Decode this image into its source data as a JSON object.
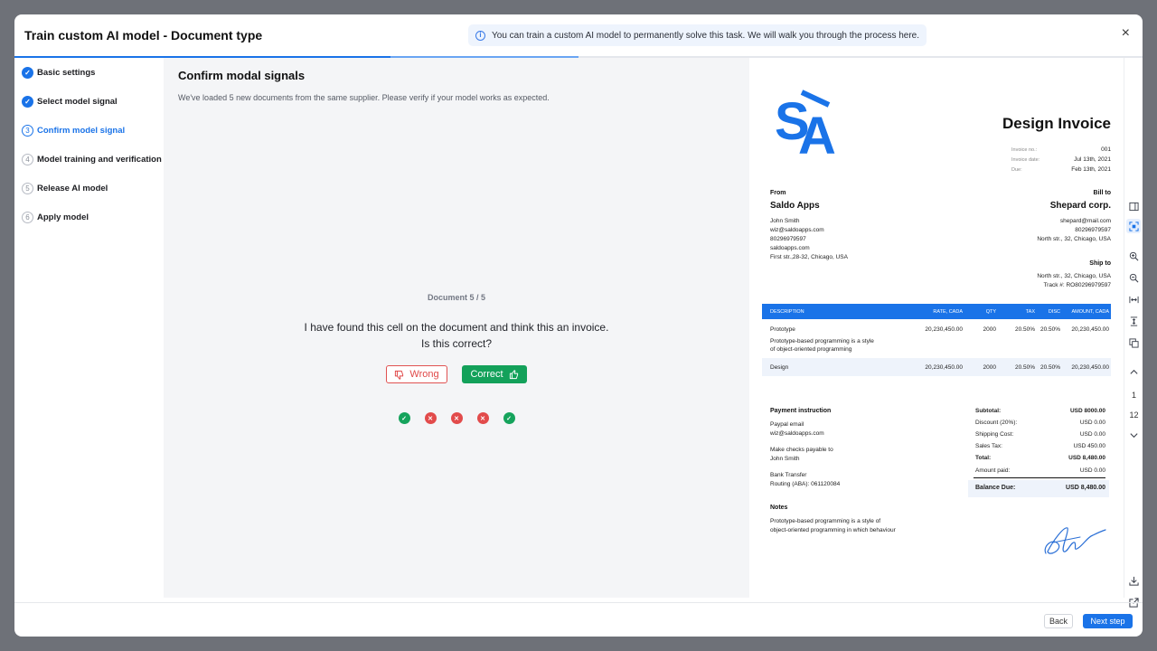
{
  "modal": {
    "title": "Train custom AI model - Document type",
    "info_banner": "You can train a custom AI model to permanently solve this task. We will walk you through the process here.",
    "close": "×"
  },
  "steps": [
    {
      "label": "Basic settings",
      "status": "done",
      "badge": "✓"
    },
    {
      "label": "Select model signal",
      "status": "done",
      "badge": "✓"
    },
    {
      "label": "Confirm model signal",
      "status": "active",
      "badge": "3"
    },
    {
      "label": "Model training and verification",
      "status": "pending",
      "badge": "4"
    },
    {
      "label": "Release AI model",
      "status": "pending",
      "badge": "5"
    },
    {
      "label": "Apply model",
      "status": "pending",
      "badge": "6"
    }
  ],
  "content": {
    "title": "Confirm modal signals",
    "subtitle": "We've loaded 5 new documents from the same supplier. Please verify if your model works as expected.",
    "document_counter": "Document 5 / 5",
    "question_line1": "I have found this cell on the document and think this an invoice.",
    "question_line2": "Is this correct?",
    "wrong_label": "Wrong",
    "correct_label": "Correct",
    "results": [
      "correct",
      "wrong",
      "wrong",
      "wrong",
      "correct"
    ]
  },
  "invoice": {
    "title": "Design Invoice",
    "meta": [
      {
        "label": "Invoice no.:",
        "value": "001"
      },
      {
        "label": "Invoice date:",
        "value": "Jul 13th, 2021"
      },
      {
        "label": "Due:",
        "value": "Feb 13th, 2021"
      }
    ],
    "from_heading": "From",
    "from_name": "Saldo Apps",
    "from_lines": [
      "John Smith",
      "wiz@saldoapps.com",
      "80296979597",
      "saldoapps.com",
      "First str.,28-32, Chicago, USA"
    ],
    "bill_heading": "Bill to",
    "bill_name": "Shepard corp.",
    "bill_lines": [
      "shepard@mail.com",
      "80296979597",
      "North str., 32, Chicago, USA"
    ],
    "ship_heading": "Ship to",
    "ship_lines": [
      "North str., 32, Chicago, USA",
      "Track #: RO80296979597"
    ],
    "table_headers": [
      "DESCRIPTION",
      "RATE, CADA",
      "QTY",
      "TAX",
      "DISC",
      "AMOUNT, CADA"
    ],
    "rows": [
      {
        "desc": "Prototype",
        "note1": "Prototype-based programming is a style",
        "note2": "of object-oriented programming",
        "rate": "20,230,450.00",
        "qty": "2000",
        "tax": "20.50%",
        "disc": "20.50%",
        "amount": "20,230,450.00"
      },
      {
        "desc": "Design",
        "rate": "20,230,450.00",
        "qty": "2000",
        "tax": "20.50%",
        "disc": "20.50%",
        "amount": "20,230,450.00"
      }
    ],
    "payment_heading": "Payment instruction",
    "payment_lines": [
      "Paypal email",
      "wiz@saldoapps.com",
      "Make checks payable to",
      "John Smith",
      "Bank Transfer",
      "Routing (ABA): 061120084"
    ],
    "totals": [
      {
        "label": "Subtotal:",
        "value": "USD 8000.00"
      },
      {
        "label": "Discount (20%):",
        "value": "USD 0.00"
      },
      {
        "label": "Shipping Cost:",
        "value": "USD 0.00"
      },
      {
        "label": "Sales Tax:",
        "value": "USD 450.00"
      },
      {
        "label": "Total:",
        "value": "USD 8,480.00"
      },
      {
        "label": "Amount paid:",
        "value": "USD 0.00"
      }
    ],
    "balance_label": "Balance Due:",
    "balance_value": "USD 8,480.00",
    "notes_heading": "Notes",
    "notes_lines": [
      "Prototype-based programming is a style of",
      "object-oriented programming in which behaviour"
    ]
  },
  "toolbar": {
    "page_current": "1",
    "page_total": "12"
  },
  "footer": {
    "back_label": "Back",
    "next_label": "Next step"
  },
  "colors": {
    "accent": "#1a73e8",
    "success": "#13a15a",
    "danger": "#e04848"
  }
}
